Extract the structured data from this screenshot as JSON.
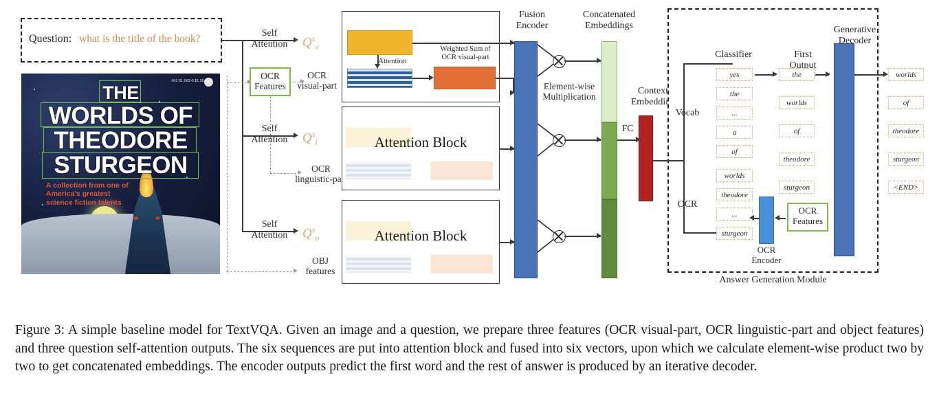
{
  "figure": {
    "question_prefix": "Question:",
    "question_text": "what is the title of the book?",
    "caption": "Figure 3: A simple baseline model for TextVQA. Given an image and a question, we prepare three features (OCR visual-part, OCR linguistic-part and object features) and three question self-attention outputs. The six sequences are put into attention block and fused into six vectors, upon which we calculate element-wise product two by two to get concatenated embeddings. The encoder outputs predict the first word and the rest of answer is produced by an iterative decoder."
  },
  "cover": {
    "line1": "THE",
    "line2": "WORLDS OF",
    "line3": "THEODORE",
    "line4": "STURGEON",
    "tagline": "A collection from one of\nAmerica's greatest\nscience fiction talents",
    "barcode": "#01 51.063-0 $1.50"
  },
  "branches": [
    {
      "self_attention": "Self\nAttention",
      "q": {
        "base": "Q",
        "sup": "s",
        "sub": "v"
      },
      "feature_label": "OCR\nvisual-part"
    },
    {
      "self_attention": "Self\nAttention",
      "q": {
        "base": "Q",
        "sup": "s",
        "sub": "l"
      },
      "feature_label": "OCR\nlinguistic-part"
    },
    {
      "self_attention": "Self\nAttention",
      "q": {
        "base": "Q",
        "sup": "s",
        "sub": "o"
      },
      "feature_label": "OBJ\nfeatures"
    }
  ],
  "ocr_features_left": "OCR\nFeatures",
  "attention_block_top": {
    "attention_label": "Attention",
    "weighted_sum_label": "Weighted Sum of\nOCR visual-part"
  },
  "attention_blocks": [
    {
      "label": "Attention Block"
    },
    {
      "label": "Attention Block"
    }
  ],
  "fusion": {
    "encoder_label": "Fusion\nEncoder",
    "elementwise_label": "Element-wise\nMultiplication",
    "concat_label": "Concatenated\nEmbeddings",
    "fc_label": "FC",
    "context_label": "Context\nEmbedding"
  },
  "answer_module": {
    "title": "Answer Generation Module",
    "classifier_label": "Classifier",
    "vocab_label": "Vocab",
    "ocr_label": "OCR",
    "first_output_label": "First\nOutput",
    "decoder_label": "Generative\nDecoder",
    "ocr_encoder_label": "OCR\nEncoder",
    "ocr_features_label": "OCR\nFeatures",
    "vocab_items": [
      {
        "text": "yes",
        "kind": "vocab"
      },
      {
        "text": "the",
        "kind": "vocab"
      },
      {
        "text": "...",
        "kind": "vocab"
      },
      {
        "text": "a",
        "kind": "vocab"
      },
      {
        "text": "of",
        "kind": "vocab"
      }
    ],
    "ocr_items": [
      {
        "text": "worlds",
        "kind": "ocr"
      },
      {
        "text": "theodore",
        "kind": "ocr"
      },
      {
        "text": "...",
        "kind": "ocr"
      },
      {
        "text": "sturgeon",
        "kind": "ocr"
      }
    ],
    "first_output_items": [
      {
        "text": "the",
        "kind": "vocab"
      },
      {
        "text": "worlds",
        "kind": "ocr"
      },
      {
        "text": "of",
        "kind": "vocab"
      },
      {
        "text": "theodore",
        "kind": "ocr"
      },
      {
        "text": "sturgeon",
        "kind": "ocr"
      }
    ],
    "final_output_items": [
      {
        "text": "worlds",
        "kind": "ocr"
      },
      {
        "text": "of",
        "kind": "vocab"
      },
      {
        "text": "theodore",
        "kind": "ocr"
      },
      {
        "text": "sturgeon",
        "kind": "ocr"
      },
      {
        "text": "<END>",
        "kind": "vocab"
      }
    ]
  },
  "colors": {
    "yellow": "#f0b52c",
    "orange": "#e07034",
    "blue_bar": "#4a72b8",
    "blue_stripe": "#2e5f96",
    "green_light": "#dcebc8",
    "green_mid": "#7aa94e",
    "green_dark": "#5f8c3c",
    "red_bar": "#b22222",
    "ocr_green": "#76c043",
    "question_orange": "#d98c4a"
  }
}
